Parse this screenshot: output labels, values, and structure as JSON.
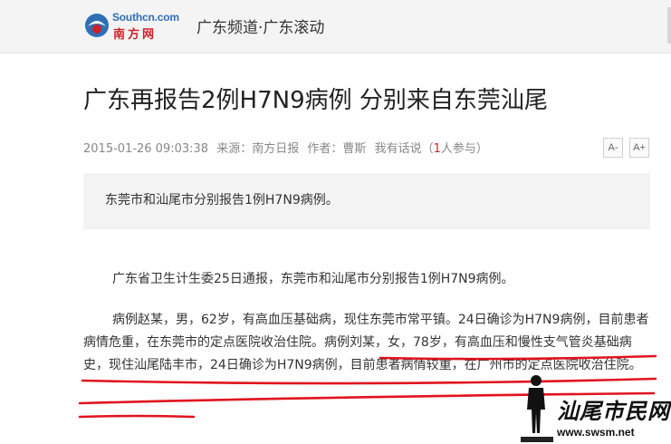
{
  "header": {
    "logo_en": "Southcn.com",
    "logo_cn": "南方网",
    "channel": "广东频道·广东滚动"
  },
  "article": {
    "title": "广东再报告2例H7N9病例 分别来自东莞汕尾",
    "meta": {
      "datetime": "2015-01-26 09:03:38",
      "source_label": "来源：",
      "source": "南方日报",
      "author_label": "作者：",
      "author": "曹斯",
      "comment_prefix": "我有话说（",
      "comment_count": "1",
      "comment_suffix": "人参与）"
    },
    "font_smaller": "A-",
    "font_larger": "A+",
    "summary": "东莞市和汕尾市分别报告1例H7N9病例。",
    "paragraphs": {
      "p1": "广东省卫生计生委25日通报，东莞市和汕尾市分别报告1例H7N9病例。",
      "p2": "病例赵某，男，62岁，有高血压基础病，现住东莞市常平镇。24日确诊为H7N9病例，目前患者病情危重，在东莞市的定点医院收治住院。病例刘某，女，78岁，有高血压和慢性支气管炎基础病史，现住汕尾陆丰市，24日确诊为H7N9病例，目前患者病情较重，在广州市的定点医院收治住院。"
    }
  },
  "watermark": {
    "name": "汕尾市民网",
    "url": "www.swsm.net"
  },
  "colors": {
    "annotation": "#e0141e",
    "brand_red": "#d0202a",
    "brand_blue": "#2f6fb5"
  }
}
